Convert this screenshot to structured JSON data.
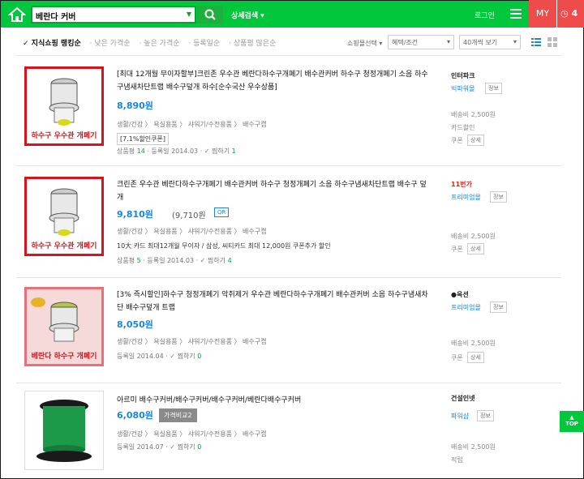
{
  "header": {
    "search_query": "베란다 커버",
    "advanced_search": "상세검색 ▾",
    "login": "로그인",
    "my": "MY",
    "recent_count": "4"
  },
  "sort": {
    "options": [
      "✓ 지식쇼핑 랭킹순",
      "· 낮은 가격순",
      "· 높은 가격순",
      "· 등록일순",
      "· 상품평 많은순"
    ]
  },
  "filters": {
    "mall_select": "쇼핑몰선택 ▾",
    "benefit": "혜택/조건",
    "per_page": "40개씩 보기"
  },
  "products": [
    {
      "title": "[최대 12개월 무이자할부]크린존 우수관 베란다하수구개폐기 배수관커버 하수구 청정개폐기 소음 하수구냄새차단트랩 배수구덮개 하수[순수국산 우수상품]",
      "price": "8,890원",
      "categories": "생활/건강 〉 욕실용품 〉 샤워기/수전용품 〉 배수구캡",
      "extra": "",
      "coupon": "[7.1%할인쿠폰]",
      "meta": [
        "상품평 ",
        "14",
        " · 등록일 2014.03 · ✓ 찜하기 ",
        "1"
      ],
      "mall": "인터파크",
      "mall_grade": "빅파워몰",
      "grade_tag": "정보",
      "shipping": "배송비 2,500원",
      "side_extra": "카드할인",
      "coupon_side": "쿠폰",
      "detail": "상세",
      "thumb_caption": "하수구 우수관 개폐기"
    },
    {
      "title": "크린존 우수관 베란다하수구개폐기 배수관커버 하수구 청정개폐기 소음 하수구냄새차단트랩 배수구 덮개",
      "price": "9,810원",
      "price_alt": "(9,710원",
      "qr": "QR",
      "categories": "생활/건강 〉 욕실용품 〉 샤워기/수전용품 〉 배수구캡",
      "extra": "10大 카드 최대12개월 무이자 / 삼성, 씨티카드 최대 12,000원 쿠폰추가 할인",
      "meta": [
        "상품평 ",
        "5",
        " · 등록일 2014.03 · ✓ 찜하기 ",
        "4"
      ],
      "mall": "11번가",
      "mall_grade": "프리미엄몰",
      "grade_tag": "정보",
      "shipping": "배송비 2,500원",
      "coupon_side": "쿠폰",
      "detail": "상세",
      "thumb_caption": "하수구 우수관 개폐기"
    },
    {
      "title": "[3% 즉시할인]하수구 청정개폐기 악취제거 우수관 베란다하수구개폐기 배수관커버 소음 하수구냄새차단 배수구덮개 트랩",
      "price": "8,050원",
      "categories": "생활/건강 〉 욕실용품 〉 샤워기/수전용품 〉 배수구캡",
      "meta": [
        "등록일 2014.04 · ✓ 찜하기 ",
        "0"
      ],
      "mall": "●옥션",
      "mall_grade": "프리미엄몰",
      "grade_tag": "정보",
      "shipping": "배송비 2,500원",
      "coupon_side": "쿠폰",
      "detail": "상세",
      "thumb_caption": "베란다 하수구 개폐기"
    },
    {
      "title": "아르미 배수구커버/배수구커버/배수구커버/베란다배수구커버",
      "price": "6,080원",
      "compare": "가격비교2",
      "categories": "생활/건강 〉 욕실용품 〉 샤워기/수전용품 〉 배수구캡",
      "meta": [
        "등록일 2014.07 · ✓ 찜하기 ",
        "0"
      ],
      "mall": "건설인넷",
      "mall_grade": "파워샵",
      "grade_tag": "정보",
      "shipping": "배송비 2,500원",
      "side_extra": "적립"
    }
  ],
  "top_button": "TOP"
}
